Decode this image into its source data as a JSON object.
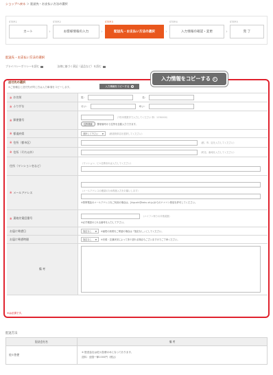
{
  "breadcrumb": {
    "back_link": "ショップへ戻る",
    "sep": "＞",
    "current": "配送先・お支払い方法の選択"
  },
  "steps": [
    {
      "num": "STEP.1",
      "label": "カート",
      "active": false
    },
    {
      "num": "STEP.2",
      "label": "お客様情報の入力",
      "active": false
    },
    {
      "num": "STEP.3",
      "label": "配送先・お支払い方法の選択",
      "active": true
    },
    {
      "num": "STEP.4",
      "label": "入力情報の確認・変更",
      "active": false
    },
    {
      "num": "STEP.5",
      "label": "完 了",
      "active": false
    }
  ],
  "section_title": "配送先・お支払い方法の選択",
  "privacy": {
    "policy": "プライバシーポリシーを読む",
    "law": "法律に基づく表記（返品など）を読む"
  },
  "copy_big_label": "入力情報をコピーする",
  "shipping": {
    "label": "送付先の選択",
    "note": "※ご依頼主と送付先が同じ方は入力事項をコピーします。",
    "copy_small_label": "入力情報をコピーする"
  },
  "form": {
    "req_mark": "※",
    "name": {
      "label": "お名前",
      "sei": "姓：",
      "mei": "名："
    },
    "kana": {
      "label": "ふりがな",
      "sei": "せい：",
      "mei": "めい："
    },
    "zip": {
      "label": "郵便番号",
      "hint": "（7桁半角数字で入力してください 例：1230000）",
      "search_btn": "住所検索",
      "search_note": "郵便番号から住所を自動入力できます。"
    },
    "pref": {
      "label": "都道府県",
      "select": "選択して下さい",
      "hint": "（都道府県名を選択してください）"
    },
    "city": {
      "label": "住所（都市区）",
      "hint": "（都、市、区を入力してください）"
    },
    "town": {
      "label": "住所（それ以外）",
      "hint": "（町名、番地を入力してください）"
    },
    "building": {
      "label": "住所（マンション名など）",
      "hint": "（マンション、ビル名等あれば入力してください）"
    },
    "email": {
      "label": "メールアドレス",
      "hint": "（メールアドレスの確認のため再度入力をお願いします）",
      "note": "※携帯電話のメールアドレスをご利用の場合は、[higushi@kaku-sti.jp]からのドメイン受信を許可してください。"
    },
    "phone": {
      "label": "連絡先電話番号",
      "hint": "（ハイフン有りの半角英数）",
      "note": "※必ず確認のとれる番号を入力して下さい。"
    },
    "date": {
      "label": "お届け希望日",
      "select": "指定なし",
      "note": "※最短の到着をご希望の場合は「指定なし」にしてください。"
    },
    "time": {
      "label": "お届け希望時間",
      "select": "指定なし",
      "note": "※天候・交通状況によって多少遅れる場合もございますのでご了承ください。"
    },
    "remarks": {
      "label": "備 考"
    }
  },
  "required_note": "※は必須です。",
  "delivery": {
    "title": "配送方法",
    "col_company": "配送会社名",
    "col_note": "備 考",
    "rows": [
      {
        "company": "佐川急便",
        "note1": "※ 配送会社は佐川急便のみとなっております。",
        "note2": "送料：全国一律1000円（税込）"
      }
    ]
  }
}
